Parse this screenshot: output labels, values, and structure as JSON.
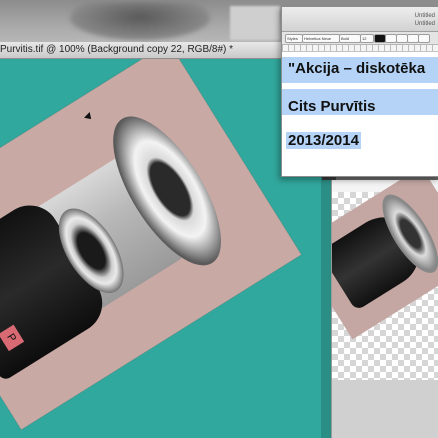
{
  "document": {
    "title": "Purvitis.tif @ 100% (Background copy 22, RGB/8#) *",
    "layer_letter": "P"
  },
  "editor": {
    "window_title": "Untitled",
    "window_subtitle": "Untitled",
    "toolbar": {
      "style": "Styles",
      "font": "Helvetica Neue",
      "weight": "Bold",
      "size": "12"
    },
    "lines": [
      "\"Akcija – diskotēka",
      "Cits Purvītis",
      "2013/2014"
    ]
  },
  "colors": {
    "canvas": "#31a89d",
    "selection": "#b4d3f6",
    "layer": "#c9a9a4"
  }
}
